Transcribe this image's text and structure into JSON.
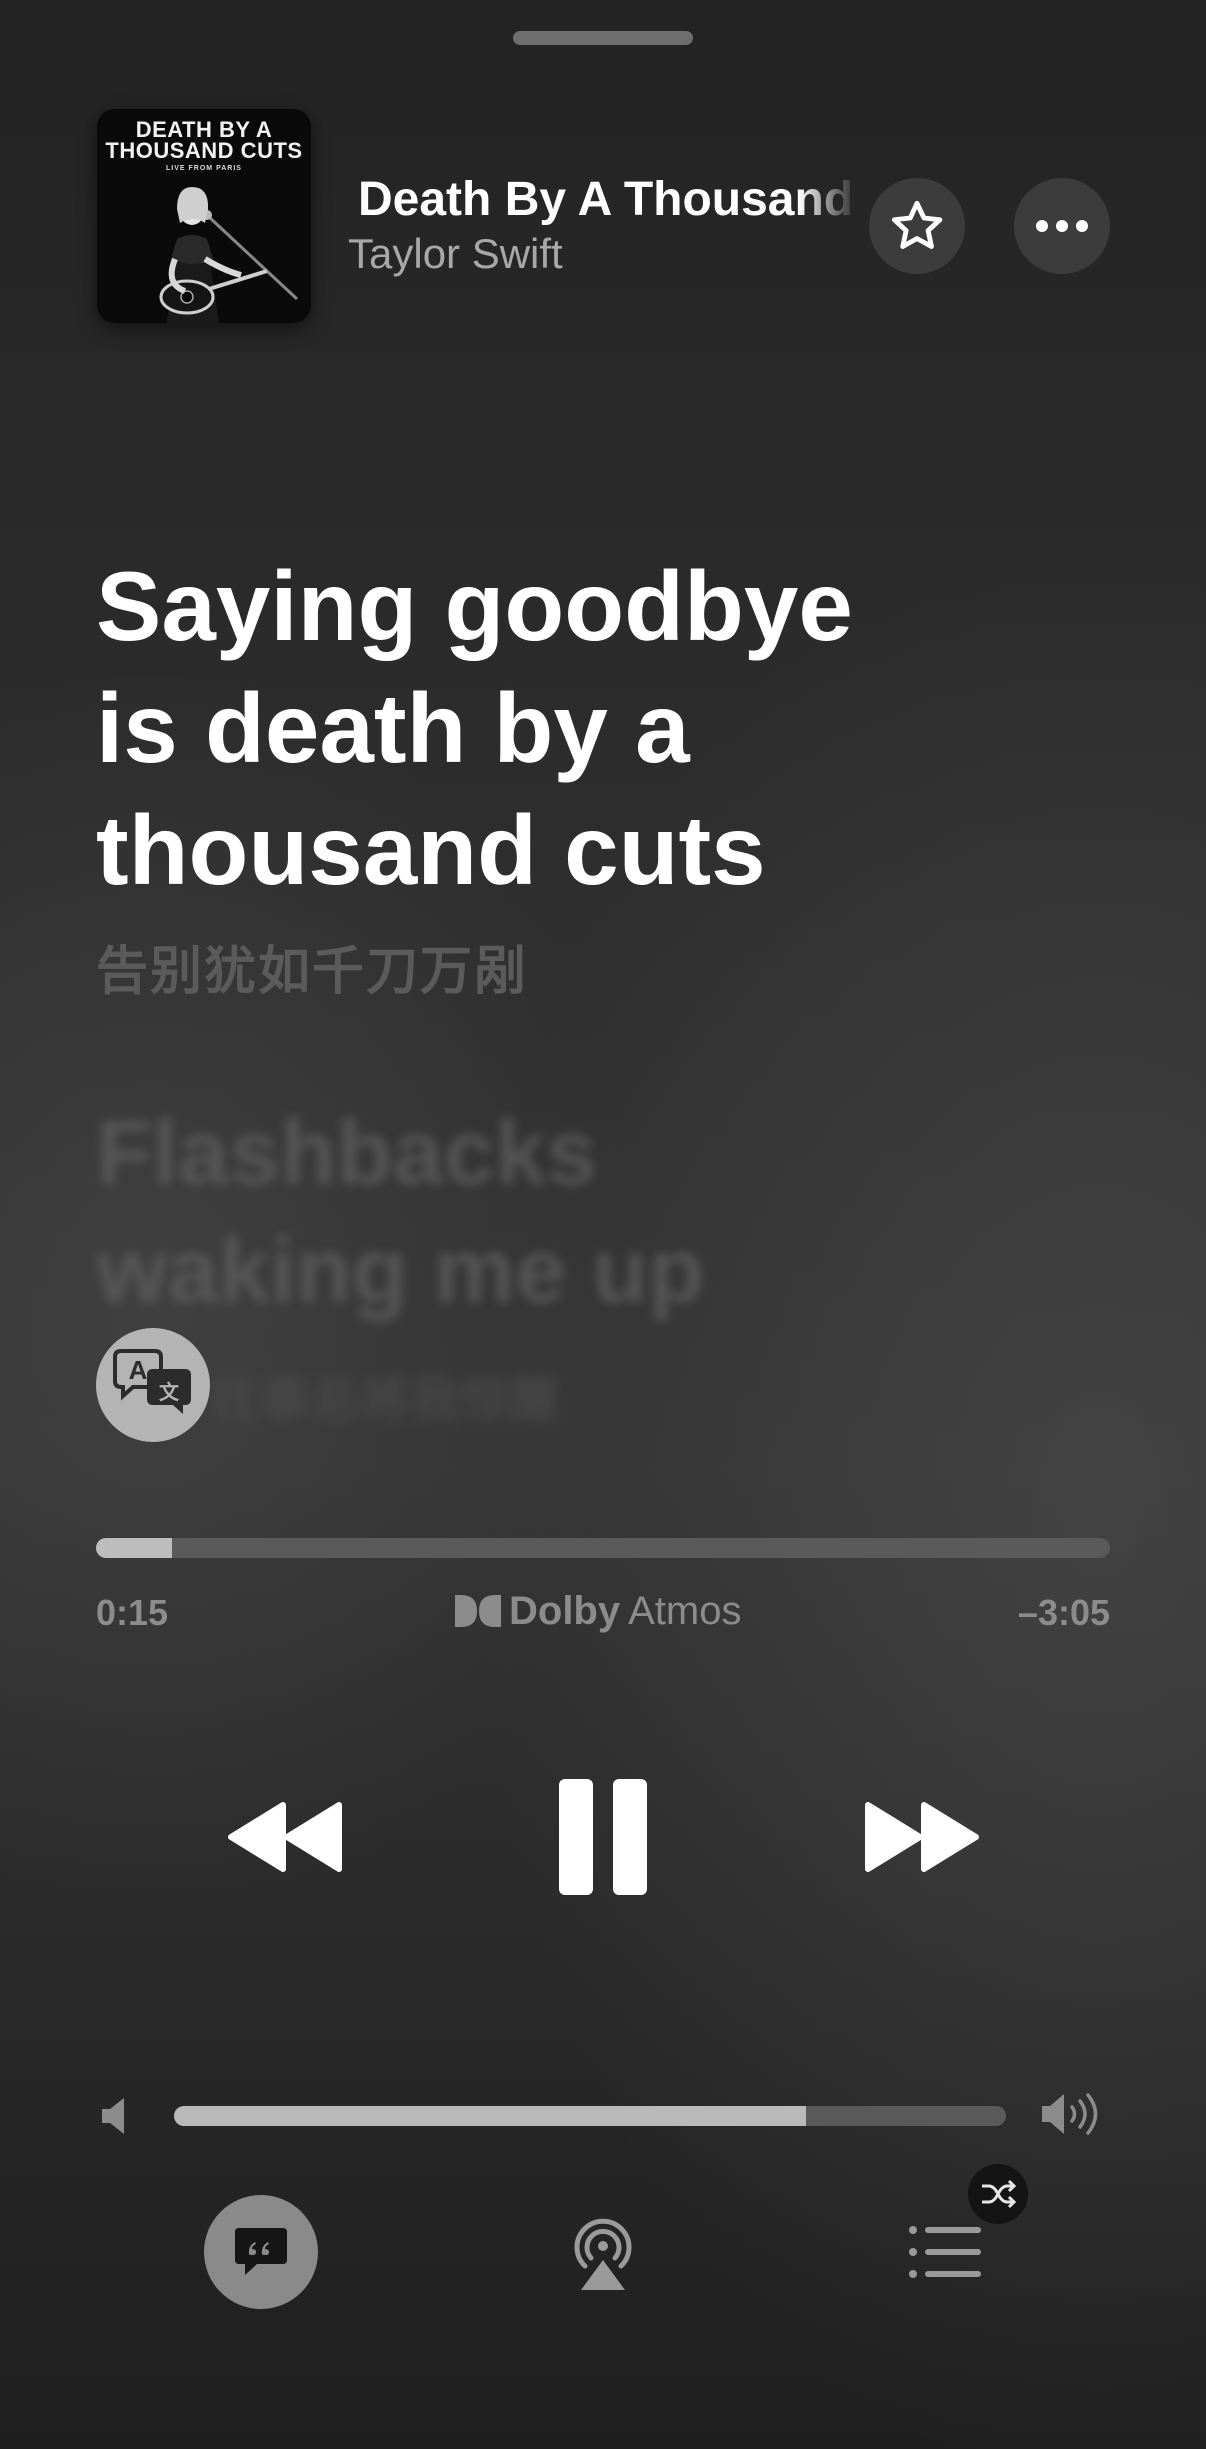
{
  "now_playing": {
    "title": "Death By A Thousand Cuts",
    "artist": "Taylor Swift",
    "artwork": {
      "title_line1": "DEATH BY A",
      "title_line2": "THOUSAND CUTS",
      "subtitle": "LIVE FROM PARIS"
    }
  },
  "header": {
    "grabber_icon": "grabber-handle",
    "favorite_icon": "star-outline-icon",
    "more_icon": "ellipsis-icon"
  },
  "lyrics": {
    "current_line": "Saying goodbye is death by a thousand cuts",
    "current_translation": "告别犹如千刀万剐",
    "next_line": "Flashbacks waking me up",
    "next_translation": "往事总将我惊醒",
    "translate_icon": "translate-bubble-icon"
  },
  "playback": {
    "elapsed": "0:15",
    "remaining": "–3:05",
    "progress": 0.075,
    "audio_format_brand": "Dolby",
    "audio_format_mode": "Atmos"
  },
  "controls": {
    "rewind_icon": "rewind-icon",
    "pause_icon": "pause-icon",
    "forward_icon": "fast-forward-icon"
  },
  "volume": {
    "level": 0.76,
    "low_icon": "speaker-low-icon",
    "high_icon": "speaker-high-icon"
  },
  "bottom_bar": {
    "lyrics_icon": "lyrics-quote-icon",
    "airplay_icon": "airplay-icon",
    "queue_icon": "queue-list-icon",
    "shuffle_icon": "shuffle-icon"
  },
  "colors": {
    "background": "#2b2b2b",
    "primary_text": "#ffffff",
    "secondary_text": "#a8a8a8",
    "inactive_lyric": "#5f5f5f",
    "progress_fill": "#bdbdbd",
    "progress_track": "#5a5a5a"
  }
}
